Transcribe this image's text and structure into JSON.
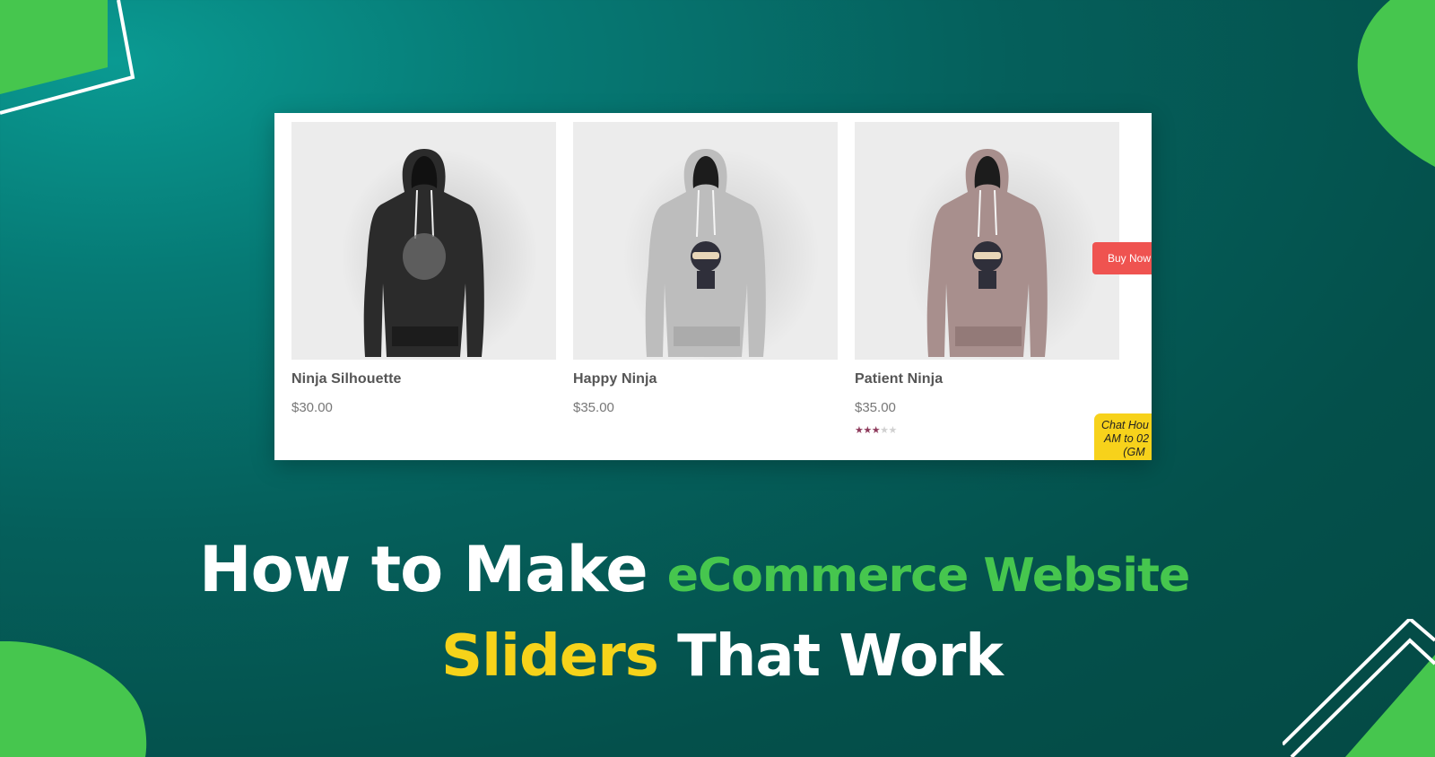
{
  "products": [
    {
      "title": "Ninja Silhouette",
      "price": "$30.00",
      "hoodie_color": "#2b2b2b",
      "graphic": "silhouette"
    },
    {
      "title": "Happy Ninja",
      "price": "$35.00",
      "hoodie_color": "#bdbdbd",
      "graphic": "ninja"
    },
    {
      "title": "Patient Ninja",
      "price": "$35.00",
      "hoodie_color": "#a88f8d",
      "graphic": "ninja",
      "rating": 3,
      "rating_max": 5
    }
  ],
  "buy_now_label": "Buy Now",
  "chat_hours_text": "Chat Hou\n AM to 02\n       (GM",
  "headline": {
    "line1_white": "How to Make",
    "line1_green": "eCommerce Website",
    "line2_yellow": "Sliders",
    "line2_white": "That Work"
  },
  "colors": {
    "accent_green": "#46c64e",
    "accent_yellow": "#f6d31a",
    "buy_now_red": "#ef5350",
    "chat_yellow": "#f7d21b",
    "star_color": "#8e3b5c"
  }
}
